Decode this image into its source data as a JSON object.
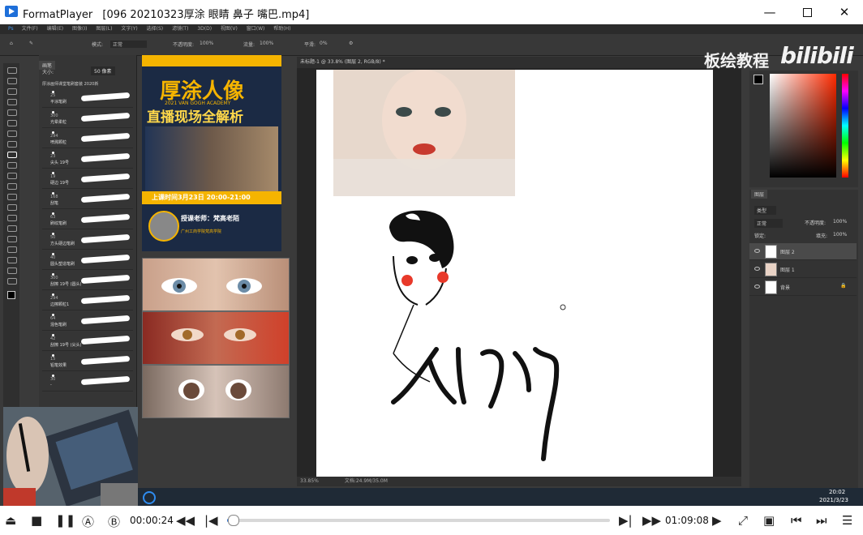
{
  "window": {
    "app_name": "FormatPlayer",
    "file_title": "[096 20210323厚涂 眼睛 鼻子 嘴巴.mp4]",
    "minimize_icon": "minimize-icon",
    "maximize_icon": "maximize-icon",
    "close_icon": "close-icon"
  },
  "video": {
    "watermark_text": "板绘教程",
    "watermark_brand": "bilibili",
    "ps_menu": [
      "文件(F)",
      "编辑(E)",
      "图像(I)",
      "图层(L)",
      "文字(Y)",
      "选择(S)",
      "滤镜(T)",
      "3D(D)",
      "视图(V)",
      "窗口(W)",
      "帮助(H)"
    ],
    "options_bar": {
      "mode_label": "模式:",
      "mode_value": "正常",
      "opacity_label": "不透明度:",
      "opacity_value": "100%",
      "flow_label": "流量:",
      "flow_value": "100%",
      "smooth_label": "平滑:",
      "smooth_value": "0%"
    },
    "brush_panel": {
      "tab": "画笔",
      "size_label": "大小:",
      "size_value": "50 像素",
      "group_name": "厚涂画师课堂笔刷套装 2020新",
      "brushes": [
        {
          "size": "25",
          "name": "平涂笔刷"
        },
        {
          "size": "300",
          "name": "光晕柔粒"
        },
        {
          "size": "294",
          "name": "喷溅颗粒"
        },
        {
          "size": "23",
          "name": "尖头 19号"
        },
        {
          "size": "19",
          "name": "硬边 19号"
        },
        {
          "size": "168",
          "name": "刮笔"
        },
        {
          "size": "63",
          "name": "刷纹笔刷"
        },
        {
          "size": "50",
          "name": "方头硬边笔刷"
        },
        {
          "size": "40",
          "name": "圆头塑造笔刷"
        },
        {
          "size": "300",
          "name": "刮擦 19号 (圆头)"
        },
        {
          "size": "294",
          "name": "边擦颗粒1"
        },
        {
          "size": "64",
          "name": "混色笔刷"
        },
        {
          "size": "42",
          "name": "刮擦 19号 (尖头)"
        },
        {
          "size": "15",
          "name": "铅笔效果"
        },
        {
          "size": "30",
          "name": "-"
        }
      ]
    },
    "poster": {
      "title_line1": "厚涂人像",
      "subtitle": "2021 VAN GOGH ACADEMY",
      "title_line2": "直播现场全解析",
      "time_text": "上课时间3月23日 20:00-21:00",
      "teacher_text": "授课老师：梵高老陌",
      "footer_text": "广州工商学院梵高学院"
    },
    "document": {
      "tab_title": "未标题-1 @ 33.8% (图层 2, RGB/8) *",
      "zoom_status": "33.85%",
      "file_status": "文档:24.9M/35.0M"
    },
    "layers": {
      "tab": "图层",
      "filter_label": "类型",
      "blend_mode": "正常",
      "opacity_label": "不透明度:",
      "opacity_value": "100%",
      "lock_label": "锁定:",
      "fill_label": "填充:",
      "fill_value": "100%",
      "items": [
        "图层 2",
        "图层 1",
        "背景"
      ]
    },
    "taskbar_clock": "20:02",
    "taskbar_date": "2021/3/23"
  },
  "player": {
    "current_time": "00:00:24",
    "total_time": "01:09:08",
    "progress": 0.006,
    "btn_a": "Ⓐ",
    "btn_b": "Ⓑ"
  },
  "colors": {
    "accent": "#3a7bd5",
    "ps_background": "#3a3a3a",
    "poster_yellow": "#f5b400",
    "blush": "#e8392a"
  }
}
